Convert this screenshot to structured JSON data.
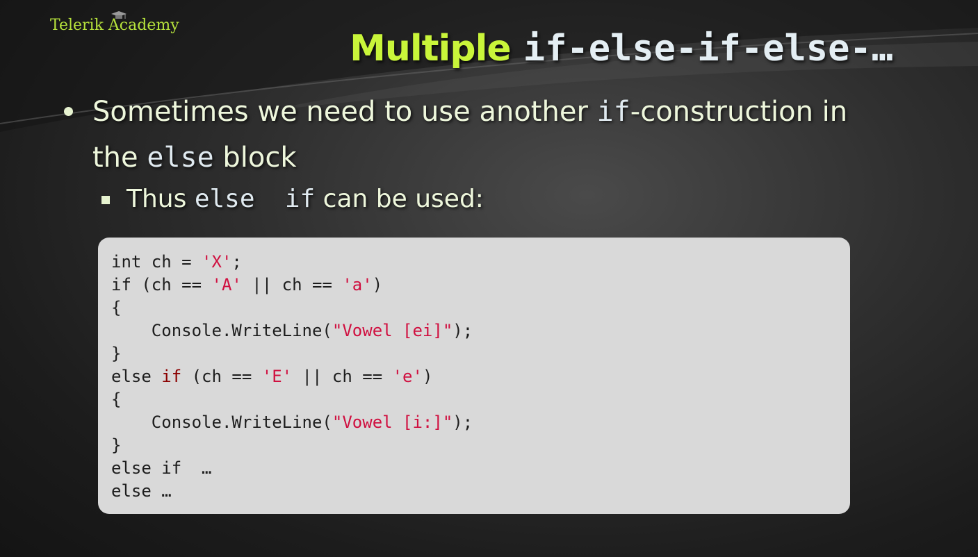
{
  "logo": {
    "text": "Telerik Academy"
  },
  "title": {
    "word": "Multiple",
    "code": "if-else-if-else-…"
  },
  "bullet1": {
    "part1": "Sometimes we need to use another ",
    "code1": "if",
    "part2": "-construction in the ",
    "code2": "else",
    "part3": " block"
  },
  "bullet2": {
    "part1": "Thus ",
    "code1": "else  if",
    "part2": " can be used:"
  },
  "code": {
    "l1": {
      "a": "int ch = ",
      "b": "'X'",
      "c": ";"
    },
    "l2": {
      "a": "if (ch == ",
      "b": "'A'",
      "c": " || ch == ",
      "d": "'a'",
      "e": ")"
    },
    "l3": "{",
    "l4": {
      "a": "    Console.WriteLine(",
      "b": "\"Vowel [ei]\"",
      "c": ");"
    },
    "l5": "}",
    "l6": {
      "a": "else ",
      "b": "if",
      "c": " (ch == ",
      "d": "'E'",
      "e": " || ch == ",
      "f": "'e'",
      "g": ")"
    },
    "l7": "{",
    "l8": {
      "a": "    Console.WriteLine(",
      "b": "\"Vowel [i:]\"",
      "c": ");"
    },
    "l9": "}",
    "l10": "else if  …",
    "l11": "else …"
  },
  "colors": {
    "title_accent": "#c9f53a",
    "logo": "#b6e23c",
    "string_literal": "#d01040",
    "keyword_highlight": "#8b0000",
    "code_background": "#d9d9d9"
  }
}
